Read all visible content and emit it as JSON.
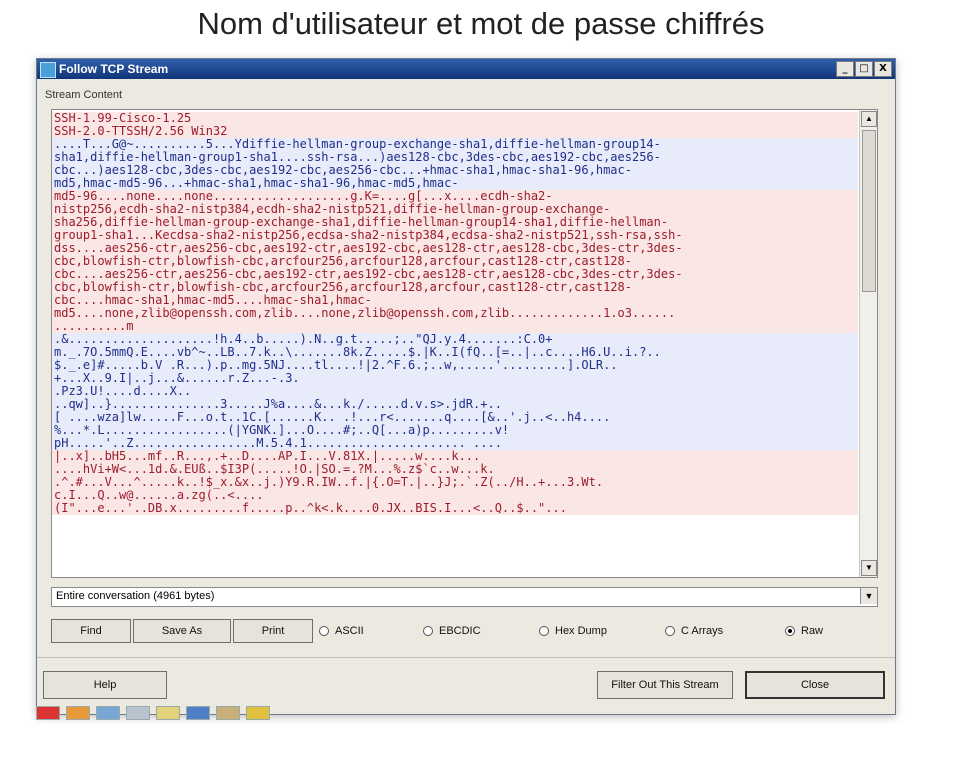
{
  "slide": {
    "title": "Nom d'utilisateur et mot de passe chiffrés"
  },
  "window": {
    "title": "Follow TCP Stream",
    "buttons": {
      "minimize": "_",
      "maximize": "□",
      "close": "X"
    }
  },
  "stream": {
    "group_label": "Stream Content",
    "lines": [
      {
        "t": "SSH-1.99-Cisco-1.25",
        "k": "c"
      },
      {
        "t": "SSH-2.0-TTSSH/2.56 Win32",
        "k": "c"
      },
      {
        "t": "....T...G@~..........5...Ydiffie-hellman-group-exchange-sha1,diffie-hellman-group14-",
        "k": "s"
      },
      {
        "t": "sha1,diffie-hellman-group1-sha1....ssh-rsa...)aes128-cbc,3des-cbc,aes192-cbc,aes256-",
        "k": "s"
      },
      {
        "t": "cbc...)aes128-cbc,3des-cbc,aes192-cbc,aes256-cbc...+hmac-sha1,hmac-sha1-96,hmac-",
        "k": "s"
      },
      {
        "t": "md5,hmac-md5-96...+hmac-sha1,hmac-sha1-96,hmac-md5,hmac-",
        "k": "s"
      },
      {
        "t": "md5-96....none....none...................g.K=....g[...x....ecdh-sha2-",
        "k": "c"
      },
      {
        "t": "nistp256,ecdh-sha2-nistp384,ecdh-sha2-nistp521,diffie-hellman-group-exchange-",
        "k": "c"
      },
      {
        "t": "sha256,diffie-hellman-group-exchange-sha1,diffie-hellman-group14-sha1,diffie-hellman-",
        "k": "c"
      },
      {
        "t": "group1-sha1...Kecdsa-sha2-nistp256,ecdsa-sha2-nistp384,ecdsa-sha2-nistp521,ssh-rsa,ssh-",
        "k": "c"
      },
      {
        "t": "dss....aes256-ctr,aes256-cbc,aes192-ctr,aes192-cbc,aes128-ctr,aes128-cbc,3des-ctr,3des-",
        "k": "c"
      },
      {
        "t": "cbc,blowfish-ctr,blowfish-cbc,arcfour256,arcfour128,arcfour,cast128-ctr,cast128-",
        "k": "c"
      },
      {
        "t": "cbc....aes256-ctr,aes256-cbc,aes192-ctr,aes192-cbc,aes128-ctr,aes128-cbc,3des-ctr,3des-",
        "k": "c"
      },
      {
        "t": "cbc,blowfish-ctr,blowfish-cbc,arcfour256,arcfour128,arcfour,cast128-ctr,cast128-",
        "k": "c"
      },
      {
        "t": "cbc....hmac-sha1,hmac-md5....hmac-sha1,hmac-",
        "k": "c"
      },
      {
        "t": "md5....none,zlib@openssh.com,zlib....none,zlib@openssh.com,zlib.............1.o3......",
        "k": "c"
      },
      {
        "t": "..........m",
        "k": "c"
      },
      {
        "t": ".&....................!h.4..b.....).N..g.t.....;..\"QJ.y.4.......:C.0+",
        "k": "s"
      },
      {
        "t": "m._.7O.5mmQ.E....vb^~..LB..7.k..\\.......8k.Z.....$.|K..I(fQ..[=..|..c....H6.U..i.?..",
        "k": "s"
      },
      {
        "t": "$._.e]#.....b.V .R...).p..mg.5NJ....tl....!|2.^F.6.;..w,.....'.........].OLR..",
        "k": "s"
      },
      {
        "t": "+...X..9.I|..j...&......r.Z...-.3.",
        "k": "s"
      },
      {
        "t": ".Pz3.U!....d....X..",
        "k": "s"
      },
      {
        "t": "..qw]..}...............3.....J%a....&...k./.....d.v.s>.jdR.+..",
        "k": "s"
      },
      {
        "t": "[ ....wza]lw.....F...o.t..1C.[......K.. .!...r<.......q....[&..'.j..<..h4....",
        "k": "s"
      },
      {
        "t": "%...*.L.................(|YGNK.]...O....#;..Q[...a)p.........v!",
        "k": "s"
      },
      {
        "t": "pH.....'..Z.................M.5.4.1...................... ....",
        "k": "s"
      },
      {
        "t": "|..x]..bH5...mf..R...,.+..D....AP.I...V.81X.|.....w....k...",
        "k": "c"
      },
      {
        "t": "....hVi+W<...1d.&.EUß..$I3P(.....!O.|SO.=.?M...%.z$`c..w...k.",
        "k": "c"
      },
      {
        "t": ".^.#...V...^.....k..!$_x.&x..j.)Y9.R.IW..f.|{.O=T.|..}J;.`.Z(../H..+...3.Wt.",
        "k": "c"
      },
      {
        "t": "c.I...Q..w@......a.zg(..<....",
        "k": "c"
      },
      {
        "t": "(I\"...e...'..DB.x.........f.....p..^k<.k....0.JX..BIS.I...<..Q..$..\"...",
        "k": "c"
      }
    ]
  },
  "conversation_select": {
    "value": "Entire conversation (4961 bytes)"
  },
  "buttons": {
    "find": "Find",
    "save_as": "Save As",
    "print": "Print",
    "help": "Help",
    "filter": "Filter Out This Stream",
    "close": "Close"
  },
  "formats": [
    {
      "label": "ASCII",
      "checked": false
    },
    {
      "label": "EBCDIC",
      "checked": false
    },
    {
      "label": "Hex Dump",
      "checked": false
    },
    {
      "label": "C Arrays",
      "checked": false
    },
    {
      "label": "Raw",
      "checked": true
    }
  ],
  "colors": {
    "client_text": "#9b1d2a",
    "client_bg": "#fbe6e6",
    "server_text": "#1f2f8a",
    "server_bg": "#e8ecfa",
    "titlebar": "#1e468f"
  }
}
